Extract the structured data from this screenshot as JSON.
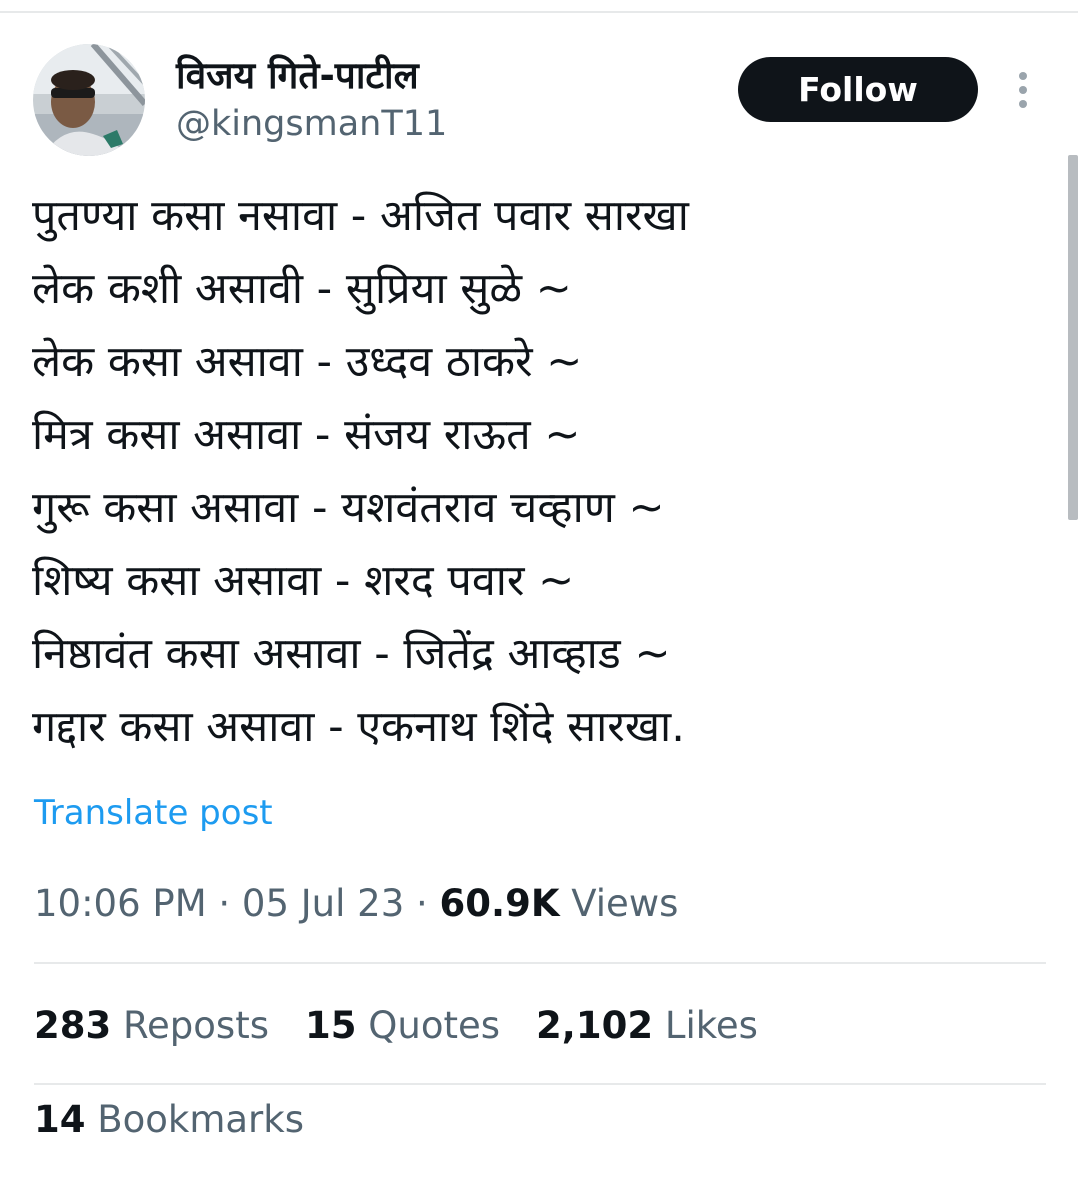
{
  "author": {
    "display_name": "विजय गिते-पाटील",
    "handle": "@kingsmanT11"
  },
  "header": {
    "follow_label": "Follow",
    "more_icon": "more-vertical-icon"
  },
  "tweet": {
    "lines": [
      "पुतण्या कसा नसावा - अजित पवार सारखा",
      "लेक कशी असावी - सुप्रिया सुळे ~",
      "लेक कसा असावा - उध्दव ठाकरे  ~",
      "मित्र कसा असावा - संजय राऊत ~",
      "गुरू कसा असावा - यशवंतराव चव्हाण ~",
      "शिष्य कसा असावा - शरद पवार ~",
      "निष्ठावंत कसा असावा - जितेंद्र आव्हाड ~",
      "गद्दार कसा असावा - एकनाथ शिंदे सारखा."
    ],
    "translate_label": "Translate post"
  },
  "meta": {
    "time": "10:06 PM",
    "separator": " · ",
    "date": "05 Jul 23",
    "views_count": "60.9K",
    "views_label": " Views"
  },
  "stats": {
    "reposts_count": "283",
    "reposts_label": " Reposts",
    "quotes_count": "15",
    "quotes_label": " Quotes",
    "likes_count": "2,102",
    "likes_label": " Likes",
    "bookmarks_count": "14",
    "bookmarks_label": " Bookmarks"
  },
  "colors": {
    "text_primary": "#0f1419",
    "text_secondary": "#536471",
    "link": "#1d9bf0",
    "button_bg": "#0f1419",
    "divider": "#e7e9ea"
  }
}
